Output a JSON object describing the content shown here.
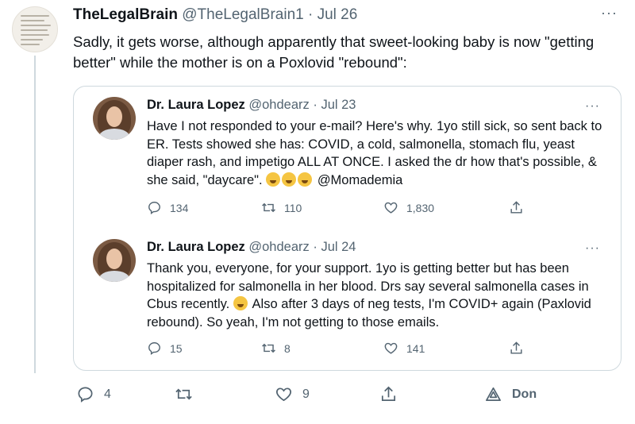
{
  "tweet": {
    "name": "TheLegalBrain",
    "handle": "@TheLegalBrain1",
    "separator": "·",
    "date": "Jul 26",
    "more": "···",
    "text": "Sadly, it gets worse, although apparently that sweet-looking baby is now \"getting better\" while the mother is on a Poxlovid \"rebound\":",
    "avatar_icon": "article-text-avatar",
    "actions": {
      "replies": "4",
      "retweets": "",
      "likes": "9",
      "promote_label": "Don"
    }
  },
  "quoted_tweets": [
    {
      "name": "Dr. Laura Lopez",
      "handle": "@ohdearz",
      "separator": "·",
      "date": "Jul 23",
      "more": "···",
      "text_before_emoji": "Have I not responded to your e-mail? Here's why. 1yo still sick, so sent back to ER. Tests showed she has: COVID, a cold, salmonella, stomach flu, yeast diaper rash, and impetigo ALL AT ONCE. I asked the dr how that's possible, & she said, \"daycare\".",
      "emoji": "tired-face-emoji x3",
      "text_after_emoji": "@Momademia",
      "replies": "134",
      "retweets": "110",
      "likes": "1,830"
    },
    {
      "name": "Dr. Laura Lopez",
      "handle": "@ohdearz",
      "separator": "·",
      "date": "Jul 24",
      "more": "···",
      "text_before_emoji": "Thank you, everyone, for your support. 1yo is getting better but has been hospitalized for salmonella in her blood. Drs say several salmonella cases in Cbus recently.",
      "emoji": "confused-face-emoji",
      "text_after_emoji": "Also after 3 days of neg tests, I'm COVID+ again (Paxlovid rebound). So yeah, I'm not getting to those emails.",
      "replies": "15",
      "retweets": "8",
      "likes": "141"
    }
  ],
  "colors": {
    "text": "#0f1419",
    "secondary": "#536471",
    "border": "#cfd9de",
    "background": "#ffffff"
  }
}
